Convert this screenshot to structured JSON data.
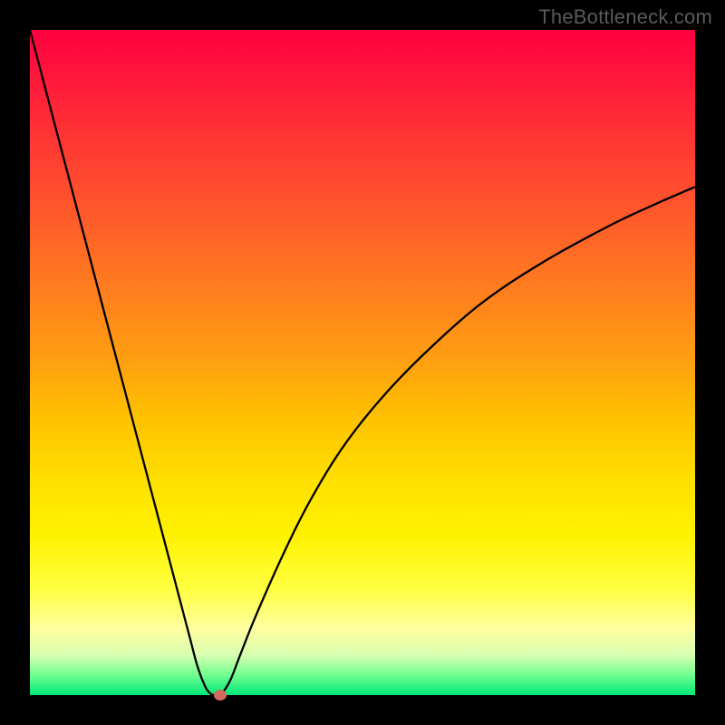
{
  "watermark": "TheBottleneck.com",
  "chart_data": {
    "type": "line",
    "title": "",
    "xlabel": "",
    "ylabel": "",
    "xlim": [
      0,
      1
    ],
    "ylim": [
      0,
      1
    ],
    "grid": false,
    "legend": false,
    "background": "rainbow-gradient-red-to-green",
    "series": [
      {
        "name": "bottleneck-curve",
        "x": [
          0.0,
          0.03,
          0.06,
          0.09,
          0.12,
          0.15,
          0.18,
          0.21,
          0.225,
          0.24,
          0.252,
          0.264,
          0.272,
          0.277,
          0.284,
          0.29,
          0.302,
          0.316,
          0.34,
          0.38,
          0.42,
          0.47,
          0.53,
          0.6,
          0.68,
          0.77,
          0.87,
          0.94,
          1.0
        ],
        "y": [
          1.0,
          0.886,
          0.772,
          0.658,
          0.544,
          0.43,
          0.316,
          0.202,
          0.145,
          0.088,
          0.043,
          0.012,
          0.002,
          0.0,
          0.0,
          0.004,
          0.024,
          0.06,
          0.12,
          0.21,
          0.29,
          0.372,
          0.448,
          0.52,
          0.59,
          0.65,
          0.705,
          0.738,
          0.764
        ]
      }
    ],
    "marker": {
      "x": 0.286,
      "y": 0.0,
      "color": "#d46a5f"
    }
  },
  "colors": {
    "gradient_top": "#ff0040",
    "gradient_bottom": "#00e878",
    "curve": "#000000",
    "watermark": "#5a5a5a",
    "dot": "#d46a5f"
  }
}
